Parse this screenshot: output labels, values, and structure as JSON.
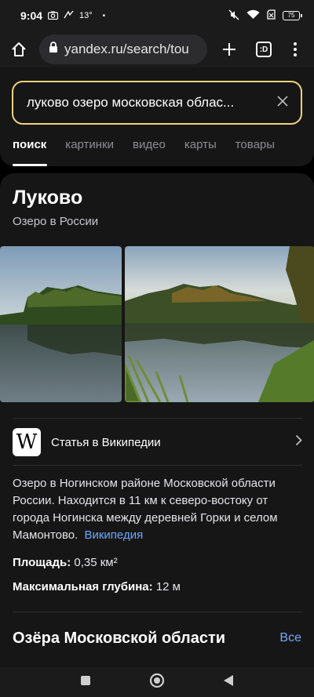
{
  "status": {
    "time": "9:04",
    "temperature": "13°",
    "battery": "75"
  },
  "browser": {
    "url": "yandex.ru/search/tou",
    "tab_count": ":D"
  },
  "search": {
    "query": "луково озеро московская облас...",
    "tabs": [
      {
        "label": "поиск",
        "active": true
      },
      {
        "label": "картинки",
        "active": false
      },
      {
        "label": "видео",
        "active": false
      },
      {
        "label": "карты",
        "active": false
      },
      {
        "label": "товары",
        "active": false
      }
    ]
  },
  "result": {
    "title": "Луково",
    "subtitle": "Озеро в России",
    "wiki_label": "Статья в Википедии",
    "wiki_logo": "W",
    "description": "Озеро в Ногинском районе Московской области России. Находится в 11 км к северо-востоку от города Ногинска между деревней Горки и селом Мамонтово.",
    "description_link": "Википедия",
    "facts": [
      {
        "label": "Площадь:",
        "value": "0,35 км²"
      },
      {
        "label": "Максимальная глубина:",
        "value": "12 м"
      }
    ],
    "section_title": "Озёра Московской области",
    "section_all": "Все"
  },
  "colors": {
    "accent_border": "#f3d27a",
    "link": "#6fa8ff",
    "card_bg": "#161616"
  }
}
